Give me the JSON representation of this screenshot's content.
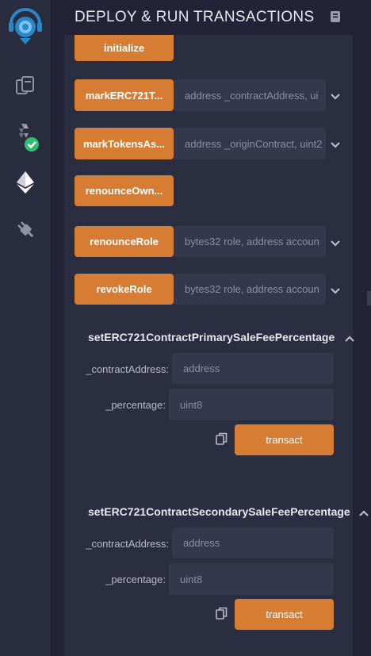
{
  "header": {
    "title": "DEPLOY & RUN TRANSACTIONS",
    "doc_icon": "book-icon"
  },
  "sidebar": {
    "items": [
      {
        "name": "logo-icon"
      },
      {
        "name": "file-explorer-icon"
      },
      {
        "name": "solidity-compiler-icon"
      },
      {
        "name": "deploy-run-icon"
      },
      {
        "name": "plugin-manager-icon"
      }
    ]
  },
  "functions": {
    "initialize": {
      "label": "initialize"
    },
    "mark_erc721": {
      "label": "markERC721T...",
      "placeholder": "address _contractAddress, ui"
    },
    "mark_tokens": {
      "label": "markTokensAs...",
      "placeholder": "address _originContract, uint2"
    },
    "renounce_ownership": {
      "label": "renounceOwn..."
    },
    "renounce_role": {
      "label": "renounceRole",
      "placeholder": "bytes32 role, address accoun"
    },
    "revoke_role": {
      "label": "revokeRole",
      "placeholder": "bytes32 role, address accoun"
    }
  },
  "primary_sale": {
    "title": "setERC721ContractPrimarySaleFeePercentage",
    "contract_label": "_contractAddress:",
    "contract_placeholder": "address",
    "percentage_label": "_percentage:",
    "percentage_placeholder": "uint8",
    "transact_label": "transact"
  },
  "secondary_sale": {
    "title": "setERC721ContractSecondarySaleFeePercentage",
    "contract_label": "_contractAddress:",
    "contract_placeholder": "address",
    "percentage_label": "_percentage:",
    "percentage_placeholder": "uint8",
    "transact_label": "transact"
  },
  "colors": {
    "accent": "#d67c33",
    "background": "#222336",
    "panel": "#2b2d40",
    "input": "#35374c",
    "success": "#2fbf71"
  }
}
